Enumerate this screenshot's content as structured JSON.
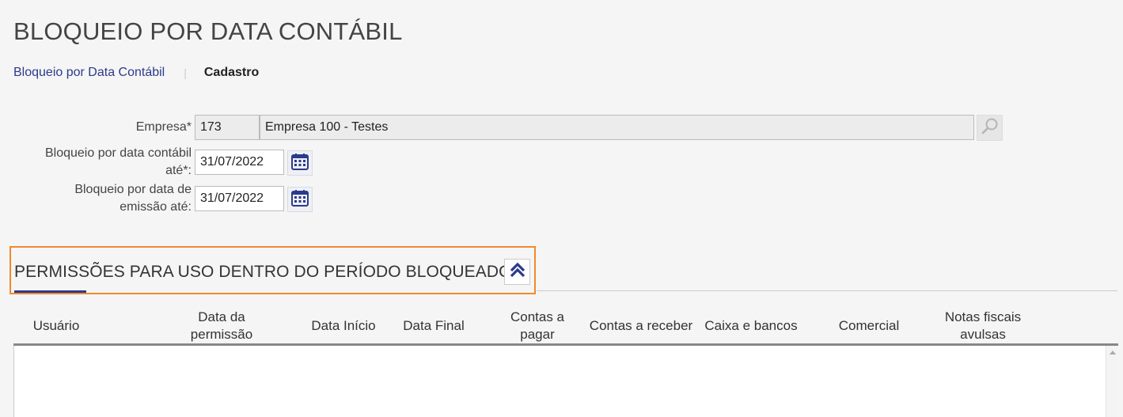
{
  "page": {
    "title": "BLOQUEIO POR DATA CONTÁBIL"
  },
  "breadcrumb": {
    "link": "Bloqueio por Data Contábil",
    "separator": "|",
    "current": "Cadastro"
  },
  "form": {
    "empresa": {
      "label": "Empresa*",
      "code": "173",
      "name": "Empresa 100 - Testes"
    },
    "bloqueio_contabil": {
      "label_line1": "Bloqueio por data contábil",
      "label_line2": "até*:",
      "value": "31/07/2022"
    },
    "bloqueio_emissao": {
      "label_line1": "Bloqueio por data de",
      "label_line2": "emissão até:",
      "value": "31/07/2022"
    }
  },
  "permissions_section": {
    "title": "PERMISSÕES PARA USO DENTRO DO PERÍODO BLOQUEADO",
    "columns": [
      {
        "line1": "Usuário",
        "line2": ""
      },
      {
        "line1": "Data da",
        "line2": "permissão"
      },
      {
        "line1": "Data Início",
        "line2": ""
      },
      {
        "line1": "Data Final",
        "line2": ""
      },
      {
        "line1": "Contas a",
        "line2": "pagar"
      },
      {
        "line1": "Contas a receber",
        "line2": ""
      },
      {
        "line1": "Caixa e bancos",
        "line2": ""
      },
      {
        "line1": "Comercial",
        "line2": ""
      },
      {
        "line1": "Notas fiscais",
        "line2": "avulsas"
      }
    ],
    "rows": []
  },
  "icons": {
    "search": "search-icon",
    "calendar": "calendar-icon",
    "collapse": "double-chevron-up-icon"
  },
  "colors": {
    "accent": "#2b3a8c",
    "highlight_border": "#f08a2e"
  }
}
